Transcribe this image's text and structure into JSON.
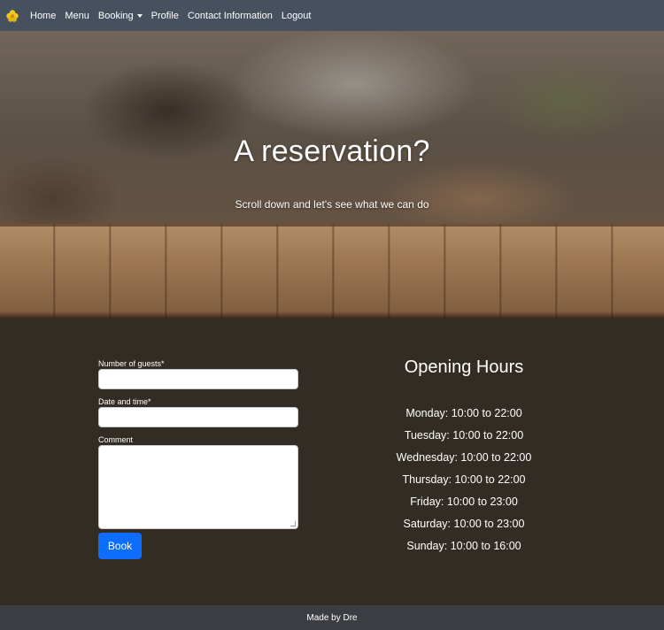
{
  "nav": {
    "brand_icon": "flower-logo-icon",
    "items": [
      {
        "label": "Home"
      },
      {
        "label": "Menu"
      },
      {
        "label": "Booking",
        "dropdown": true
      },
      {
        "label": "Profile"
      },
      {
        "label": "Contact Information"
      },
      {
        "label": "Logout"
      }
    ]
  },
  "hero": {
    "title": "A reservation?",
    "subtitle": "Scroll down and let's see what we can do"
  },
  "form": {
    "guests_label": "Number of guests*",
    "guests_value": "",
    "datetime_label": "Date and time*",
    "datetime_value": "",
    "comment_label": "Comment",
    "comment_value": "",
    "submit_label": "Book"
  },
  "hours": {
    "title": "Opening Hours",
    "rows": [
      "Monday: 10:00 to 22:00",
      "Tuesday: 10:00 to 22:00",
      "Wednesday: 10:00 to 22:00",
      "Thursday: 10:00 to 22:00",
      "Friday: 10:00 to 23:00",
      "Saturday: 10:00 to 23:00",
      "Sunday: 10:00 to 16:00"
    ]
  },
  "footer": {
    "text": "Made by Dre"
  },
  "colors": {
    "navbar": "#46505f",
    "main_bg": "#332c24",
    "button": "#0d6efd",
    "footer": "#3b3d42",
    "logo": "#f2c81b"
  }
}
